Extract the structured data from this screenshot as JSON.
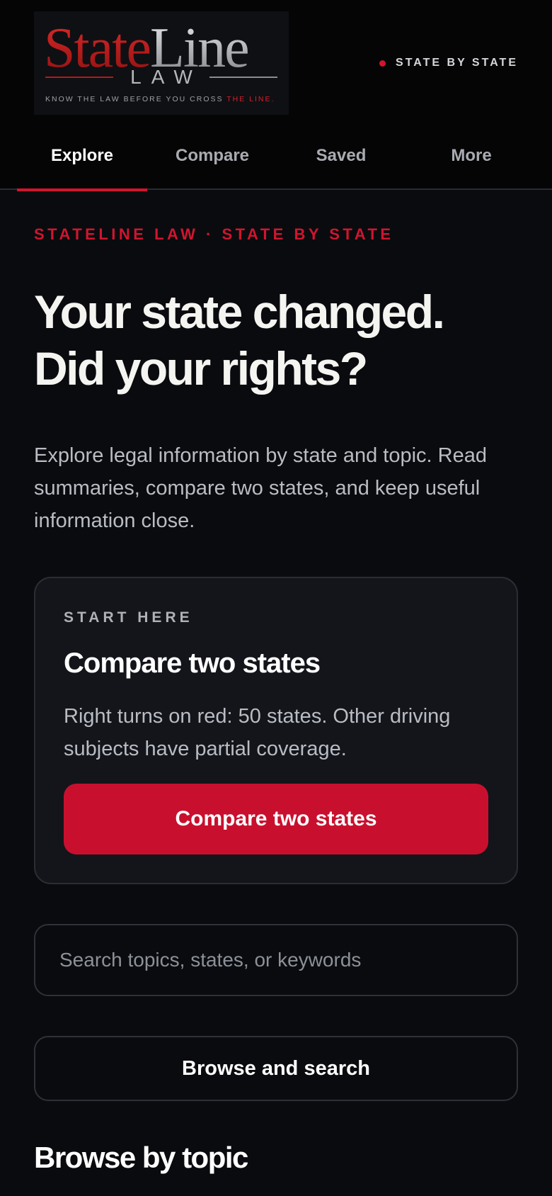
{
  "brand": {
    "word_state": "State",
    "word_line": "Line",
    "word_law": "LAW",
    "tagline_prefix": "KNOW THE LAW BEFORE YOU CROSS ",
    "tagline_accent": "THE LINE."
  },
  "header": {
    "badge_text": "STATE BY STATE"
  },
  "tabs": [
    {
      "label": "Explore",
      "active": true
    },
    {
      "label": "Compare",
      "active": false
    },
    {
      "label": "Saved",
      "active": false
    },
    {
      "label": "More",
      "active": false
    }
  ],
  "hero": {
    "eyebrow": "STATELINE LAW · STATE BY STATE",
    "headline_line1": "Your state changed.",
    "headline_line2": "Did your rights?",
    "intro": "Explore legal information by state and topic. Read summaries, compare two states, and keep useful information close."
  },
  "start_card": {
    "kicker": "START HERE",
    "title": "Compare two states",
    "body": "Right turns on red: 50 states. Other driving subjects have partial coverage.",
    "button_label": "Compare two states"
  },
  "search": {
    "placeholder": "Search topics, states, or keywords",
    "value": ""
  },
  "browse_button_label": "Browse and search",
  "section_title": "Browse by topic",
  "colors": {
    "accent": "#c8102e",
    "background": "#0a0b0e",
    "card": "#13151b"
  }
}
